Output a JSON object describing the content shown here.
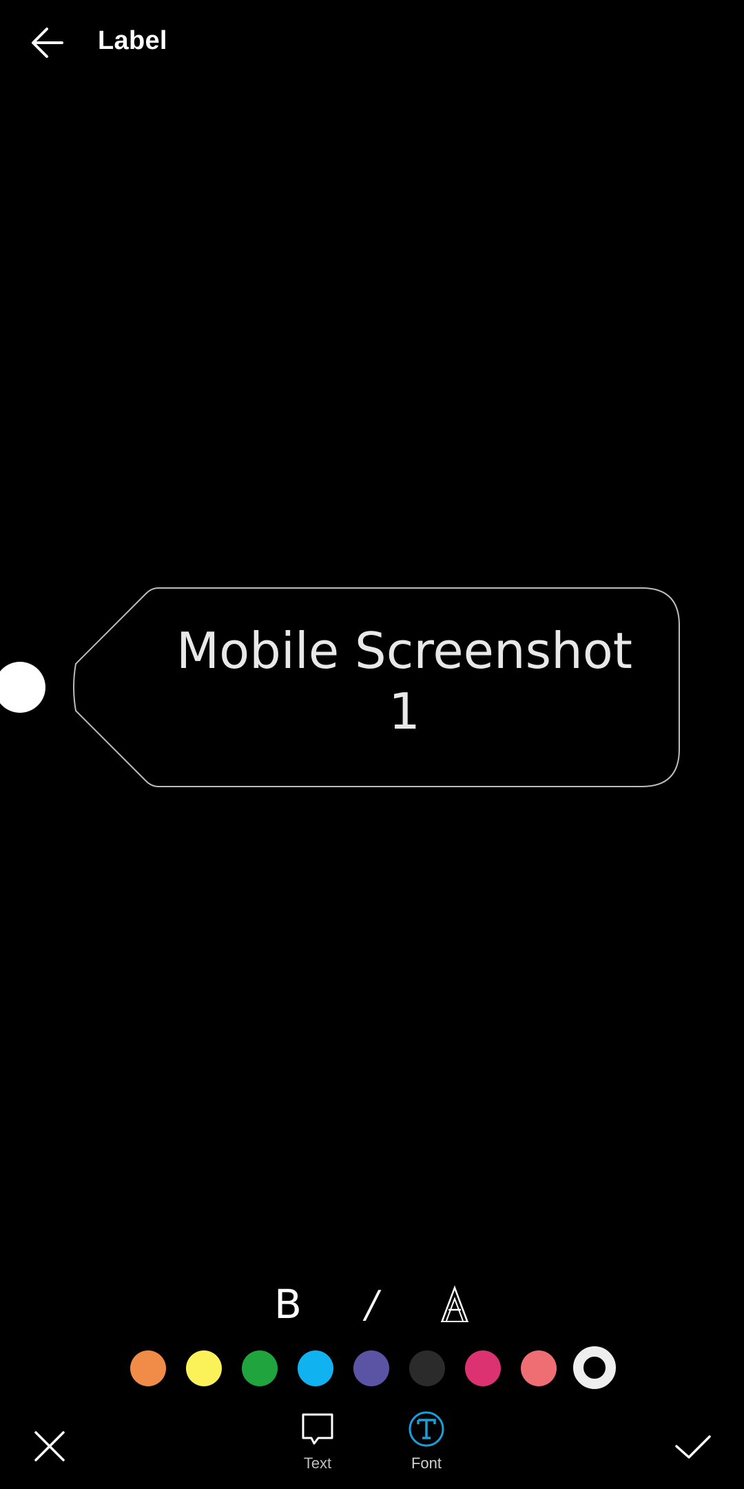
{
  "header": {
    "title": "Label",
    "back_icon": "arrow-left-icon"
  },
  "label": {
    "text_line1": "Mobile Screenshot",
    "text_line2": "1",
    "border_color": "#bdbdbd",
    "text_color": "#e8e8e8"
  },
  "style_toolbar": {
    "bold": "B",
    "italic": "/",
    "outline_icon": "outline-a-icon"
  },
  "palette": [
    {
      "name": "orange",
      "color": "#f08c48"
    },
    {
      "name": "yellow",
      "color": "#fbf25a"
    },
    {
      "name": "green",
      "color": "#1fa43e"
    },
    {
      "name": "sky-blue",
      "color": "#10b3ef"
    },
    {
      "name": "purple",
      "color": "#5b54a4"
    },
    {
      "name": "dark-gray",
      "color": "#2b2b2b"
    },
    {
      "name": "magenta",
      "color": "#dd3272"
    },
    {
      "name": "salmon",
      "color": "#ef6e74"
    },
    {
      "name": "white",
      "color": "#eeeeee",
      "selected": true
    }
  ],
  "bottom_bar": {
    "cancel_icon": "close-icon",
    "confirm_icon": "check-icon",
    "tabs": [
      {
        "label": "Text",
        "icon": "speech-bubble-icon",
        "active": false
      },
      {
        "label": "Font",
        "icon": "font-t-icon",
        "active": true,
        "active_color": "#1a9fd9"
      }
    ]
  }
}
